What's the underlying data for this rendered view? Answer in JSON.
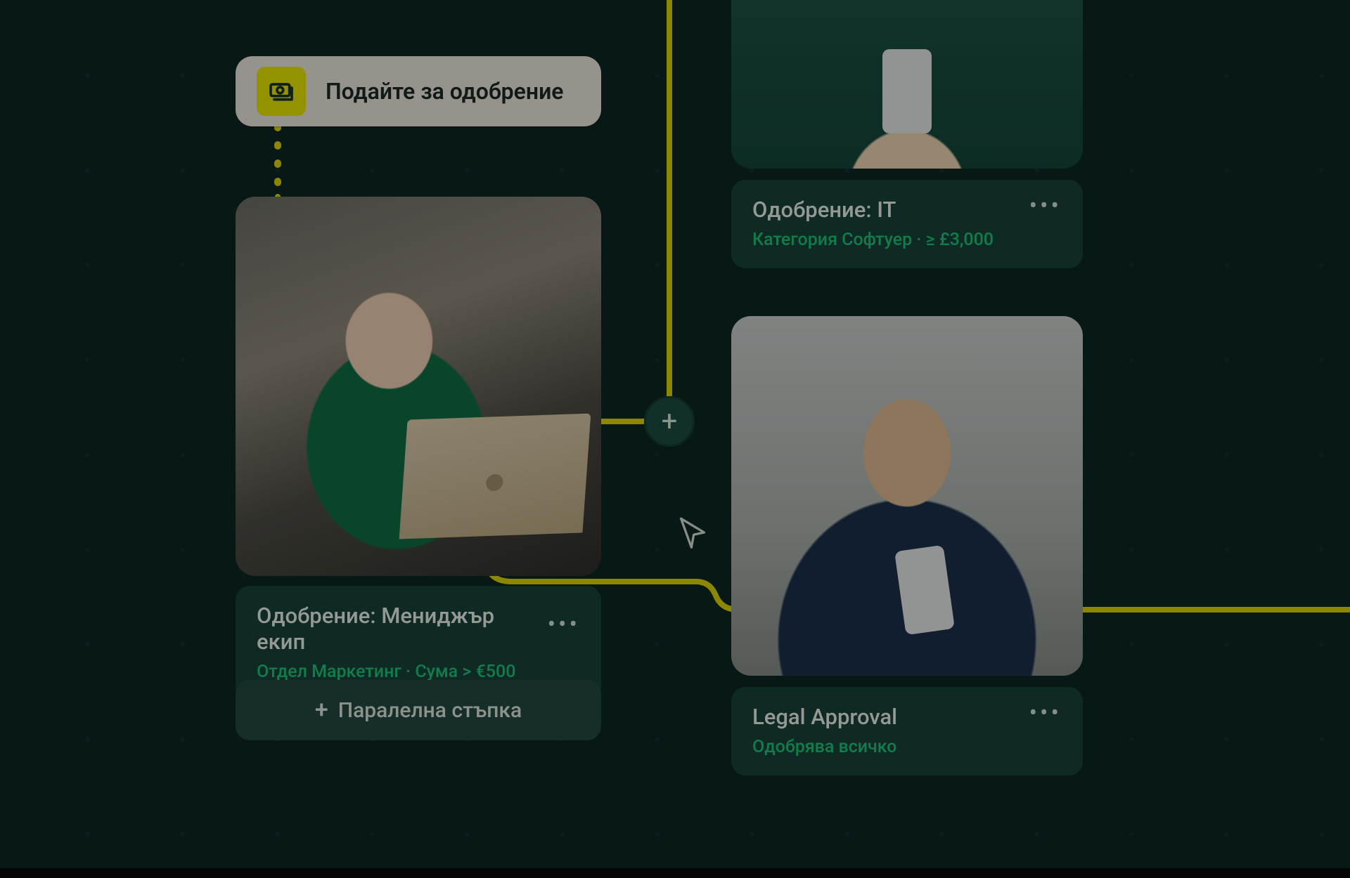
{
  "submit": {
    "label": "Подайте за одобрение",
    "icon": "cash-stack-icon"
  },
  "nodes": {
    "manager": {
      "title": "Одобрение: Мениджър екип",
      "subtitle": "Отдел Маркетинг · Сума  > €500"
    },
    "it": {
      "title": "Одобрение: IT",
      "subtitle": "Категория Софтуер  ·   ≥ £3,000"
    },
    "legal": {
      "title": "Legal Approval",
      "subtitle": "Одобрява всичко"
    }
  },
  "parallel_button": "Паралелна стъпка",
  "colors": {
    "accent_yellow": "#e4e000",
    "connector": "#d9cf00",
    "green_text": "#1cbf72",
    "card_bg": "#184038"
  }
}
